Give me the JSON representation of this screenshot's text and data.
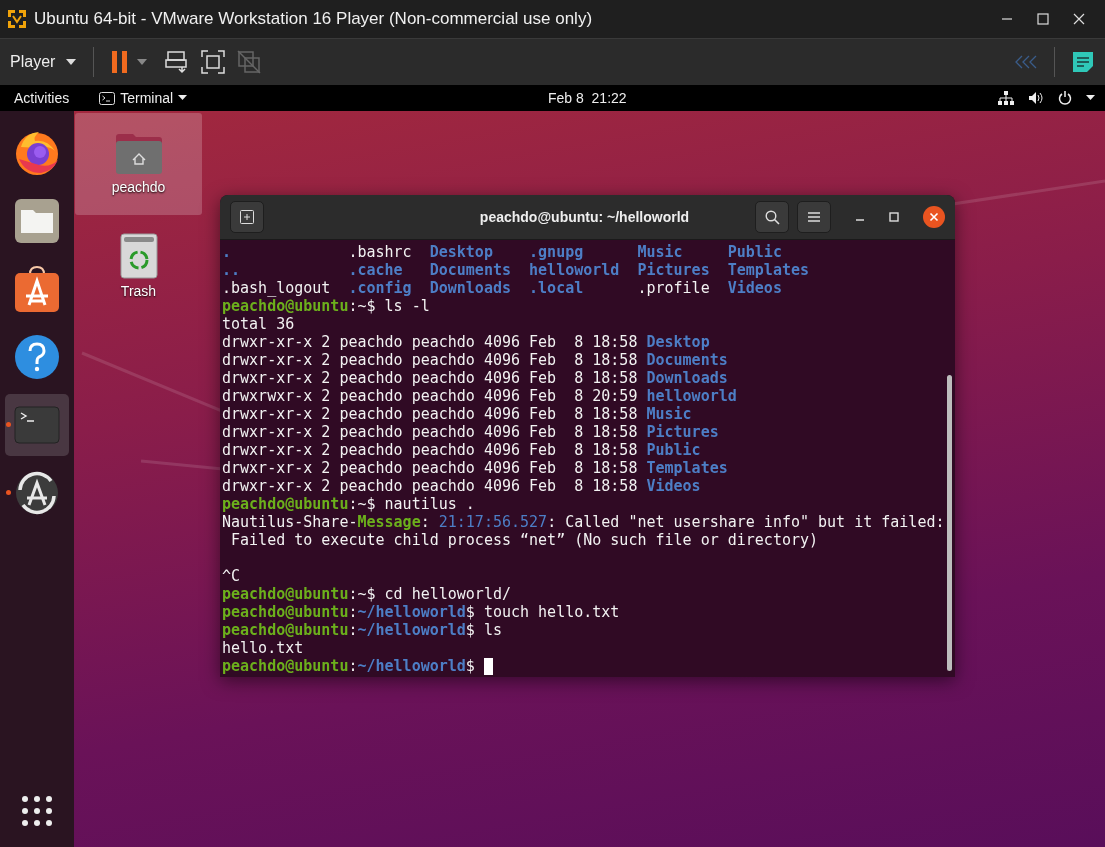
{
  "vm_window": {
    "title": "Ubuntu 64-bit - VMware Workstation 16 Player (Non-commercial use only)"
  },
  "toolbar": {
    "menu_label": "Player"
  },
  "top_bar": {
    "activities": "Activities",
    "app_menu": "Terminal",
    "clock": "Feb 8  21:22"
  },
  "dock": [
    {
      "kind": "firefox",
      "running": false,
      "selected": false
    },
    {
      "kind": "files",
      "running": false,
      "selected": false
    },
    {
      "kind": "software",
      "running": false,
      "selected": false
    },
    {
      "kind": "help",
      "running": false,
      "selected": false
    },
    {
      "kind": "terminal",
      "running": true,
      "selected": true
    },
    {
      "kind": "updater",
      "running": true,
      "selected": false
    }
  ],
  "desktop_icons": [
    {
      "kind": "home",
      "label": "peachdo",
      "selected": true
    },
    {
      "kind": "trash",
      "label": "Trash",
      "selected": false
    }
  ],
  "terminal": {
    "title": "peachdo@ubuntu: ~/helloworld",
    "cursor": true,
    "lines": [
      {
        "segments": [
          {
            "text": ".             ",
            "kind": "dir"
          },
          {
            "text": ".bashrc  ",
            "kind": "plain"
          },
          {
            "text": "Desktop    ",
            "kind": "dir"
          },
          {
            "text": ".gnupg      ",
            "kind": "dir"
          },
          {
            "text": "Music     ",
            "kind": "dir"
          },
          {
            "text": "Public",
            "kind": "dir"
          }
        ]
      },
      {
        "segments": [
          {
            "text": "..            ",
            "kind": "dir"
          },
          {
            "text": ".cache   ",
            "kind": "dir"
          },
          {
            "text": "Documents  ",
            "kind": "dir"
          },
          {
            "text": "helloworld  ",
            "kind": "dir"
          },
          {
            "text": "Pictures  ",
            "kind": "dir"
          },
          {
            "text": "Templates",
            "kind": "dir"
          }
        ]
      },
      {
        "segments": [
          {
            "text": ".bash_logout  ",
            "kind": "plain"
          },
          {
            "text": ".config  ",
            "kind": "dir"
          },
          {
            "text": "Downloads  ",
            "kind": "dir"
          },
          {
            "text": ".local      ",
            "kind": "dir"
          },
          {
            "text": ".profile  ",
            "kind": "plain"
          },
          {
            "text": "Videos",
            "kind": "dir"
          }
        ]
      },
      {
        "segments": [
          {
            "text": "peachdo@ubuntu",
            "kind": "user"
          },
          {
            "text": ":~$ ls -l",
            "kind": "plain"
          }
        ]
      },
      {
        "segments": [
          {
            "text": "total 36",
            "kind": "plain"
          }
        ]
      },
      {
        "segments": [
          {
            "text": "drwxr-xr-x 2 peachdo peachdo 4096 Feb  8 18:58 ",
            "kind": "plain"
          },
          {
            "text": "Desktop",
            "kind": "dir"
          }
        ]
      },
      {
        "segments": [
          {
            "text": "drwxr-xr-x 2 peachdo peachdo 4096 Feb  8 18:58 ",
            "kind": "plain"
          },
          {
            "text": "Documents",
            "kind": "dir"
          }
        ]
      },
      {
        "segments": [
          {
            "text": "drwxr-xr-x 2 peachdo peachdo 4096 Feb  8 18:58 ",
            "kind": "plain"
          },
          {
            "text": "Downloads",
            "kind": "dir"
          }
        ]
      },
      {
        "segments": [
          {
            "text": "drwxrwxr-x 2 peachdo peachdo 4096 Feb  8 20:59 ",
            "kind": "plain"
          },
          {
            "text": "helloworld",
            "kind": "dir"
          }
        ]
      },
      {
        "segments": [
          {
            "text": "drwxr-xr-x 2 peachdo peachdo 4096 Feb  8 18:58 ",
            "kind": "plain"
          },
          {
            "text": "Music",
            "kind": "dir"
          }
        ]
      },
      {
        "segments": [
          {
            "text": "drwxr-xr-x 2 peachdo peachdo 4096 Feb  8 18:58 ",
            "kind": "plain"
          },
          {
            "text": "Pictures",
            "kind": "dir"
          }
        ]
      },
      {
        "segments": [
          {
            "text": "drwxr-xr-x 2 peachdo peachdo 4096 Feb  8 18:58 ",
            "kind": "plain"
          },
          {
            "text": "Public",
            "kind": "dir"
          }
        ]
      },
      {
        "segments": [
          {
            "text": "drwxr-xr-x 2 peachdo peachdo 4096 Feb  8 18:58 ",
            "kind": "plain"
          },
          {
            "text": "Templates",
            "kind": "dir"
          }
        ]
      },
      {
        "segments": [
          {
            "text": "drwxr-xr-x 2 peachdo peachdo 4096 Feb  8 18:58 ",
            "kind": "plain"
          },
          {
            "text": "Videos",
            "kind": "dir"
          }
        ]
      },
      {
        "segments": [
          {
            "text": "peachdo@ubuntu",
            "kind": "user"
          },
          {
            "text": ":~$ nautilus .",
            "kind": "plain"
          }
        ]
      },
      {
        "segments": [
          {
            "text": "Nautilus-Share-",
            "kind": "plain"
          },
          {
            "text": "Message",
            "kind": "msg"
          },
          {
            "text": ": ",
            "kind": "plain"
          },
          {
            "text": "21:17:56.527",
            "kind": "time"
          },
          {
            "text": ": Called \"net usershare info\" but it failed:",
            "kind": "plain"
          }
        ]
      },
      {
        "segments": [
          {
            "text": " Failed to execute child process “net” (No such file or directory)",
            "kind": "plain"
          }
        ]
      },
      {
        "kind": "blank"
      },
      {
        "segments": [
          {
            "text": "^C",
            "kind": "plain"
          }
        ]
      },
      {
        "segments": [
          {
            "text": "peachdo@ubuntu",
            "kind": "user"
          },
          {
            "text": ":~$ cd helloworld/",
            "kind": "plain"
          }
        ]
      },
      {
        "segments": [
          {
            "text": "peachdo@ubuntu",
            "kind": "user"
          },
          {
            "text": ":",
            "kind": "plain"
          },
          {
            "text": "~/helloworld",
            "kind": "path"
          },
          {
            "text": "$ touch hello.txt",
            "kind": "plain"
          }
        ]
      },
      {
        "segments": [
          {
            "text": "peachdo@ubuntu",
            "kind": "user"
          },
          {
            "text": ":",
            "kind": "plain"
          },
          {
            "text": "~/helloworld",
            "kind": "path"
          },
          {
            "text": "$ ls",
            "kind": "plain"
          }
        ]
      },
      {
        "segments": [
          {
            "text": "hello.txt",
            "kind": "plain"
          }
        ]
      },
      {
        "segments": [
          {
            "text": "peachdo@ubuntu",
            "kind": "user"
          },
          {
            "text": ":",
            "kind": "plain"
          },
          {
            "text": "~/helloworld",
            "kind": "path"
          },
          {
            "text": "$ ",
            "kind": "plain"
          }
        ]
      }
    ]
  }
}
